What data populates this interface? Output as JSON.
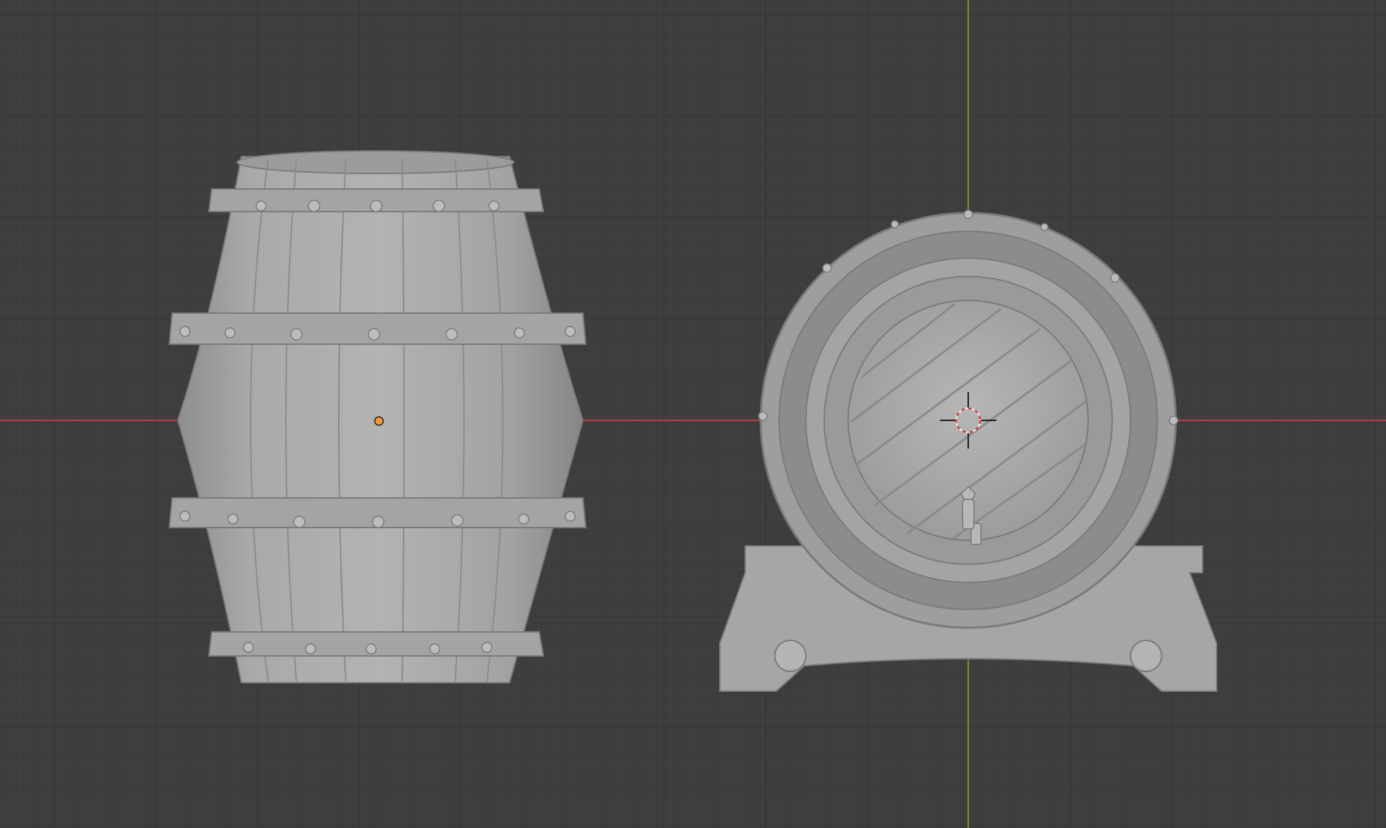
{
  "app": {
    "view": "3D viewport",
    "shading": "solid"
  },
  "colors": {
    "background": "#3d3d3d",
    "grid_minor": "#454545",
    "grid_major": "#333333",
    "x_axis": "#c23b47",
    "y_axis": "#6e9a2a",
    "mesh": "#a8a8a8",
    "mesh_dark": "#8a8a8a",
    "mesh_light": "#c2c2c2",
    "object_origin": "#f29b2d",
    "cursor_ring": "#e8e8e8"
  },
  "objects": [
    {
      "name": "barrel-standing",
      "selected": false
    },
    {
      "name": "barrel-on-stand",
      "selected": false
    }
  ],
  "icons": [
    "object-origin-icon",
    "3d-cursor-icon"
  ]
}
